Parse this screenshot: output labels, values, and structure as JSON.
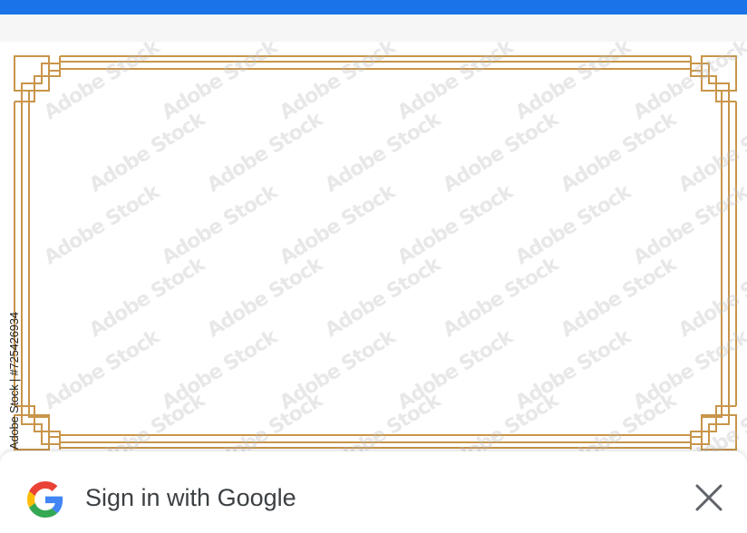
{
  "colors": {
    "top_bar": "#1a73e8",
    "frame_gold": "#c8954a",
    "sheet_text": "#3c4043",
    "close_icon": "#5f6368"
  },
  "image": {
    "credit": "Adobe Stock | #725426934",
    "watermark_text": "Adobe Stock"
  },
  "signin": {
    "title": "Sign in with Google",
    "logo_icon": "google-g-icon",
    "close_icon": "close-icon"
  }
}
